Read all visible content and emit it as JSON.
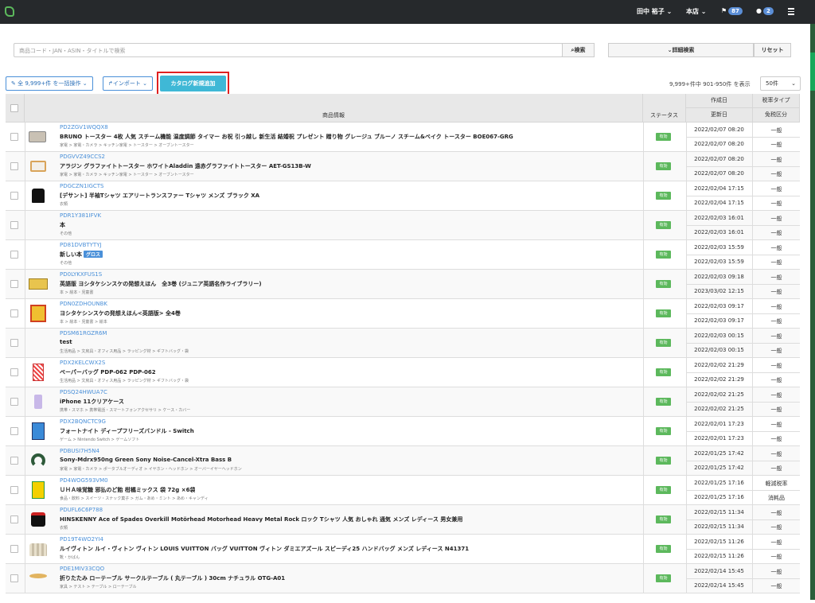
{
  "topbar": {
    "user": "田中 裕子",
    "store": "本店",
    "flag_count": "87",
    "chat_count": "2"
  },
  "search": {
    "placeholder": "商品コード・JAN・ASIN・タイトルで検索",
    "search_label": "検索",
    "advanced_label": "詳細検索",
    "reset_label": "リセット"
  },
  "actions": {
    "bulk_label": "全 9,999+件 を一括操作",
    "import_label": "インポート",
    "add_label": "カタログ新規追加"
  },
  "paging": {
    "info": "9,999+件中 901-950件 を表示",
    "per_page": "50件"
  },
  "table": {
    "headers": {
      "product": "商品情報",
      "status": "ステータス",
      "created": "作成日",
      "updated": "更新日",
      "tax": "税率タイプ",
      "excise": "免税区分"
    },
    "rows": [
      {
        "code": "PD2ZGV1WQQX8",
        "title": "BRUNO トースター 4枚 人気 スチーム機能 温度調節 タイマー お祝 引っ越し 新生活 結婚祝 プレゼント 贈り物 グレージュ ブルーノ スチーム&ベイク トースター BOE067-GRG",
        "category": "家電 > 家電・カメラ > キッチン家電 > トースター > オーブントースター",
        "status": "有効",
        "created": "2022/02/07 08:20",
        "updated": "2022/02/07 08:20",
        "tax": "一般",
        "excise": "一般",
        "thumb": "toaster"
      },
      {
        "code": "PDGVVZ49CCS2",
        "title": "アラジン グラファイトトースター ホワイトAladdin 遠赤グラファイトトースター AET-GS13B-W",
        "category": "家電 > 家電・カメラ > キッチン家電 > トースター > オーブントースター",
        "status": "有効",
        "created": "2022/02/07 08:20",
        "updated": "2022/02/07 08:20",
        "tax": "一般",
        "excise": "一般",
        "thumb": "toaster2"
      },
      {
        "code": "PDGCZN1IGCTS",
        "title": "[デサント] 半袖Tシャツ エアリートランスファー Tシャツ メンズ ブラック XA",
        "category": "衣類",
        "status": "有効",
        "created": "2022/02/04 17:15",
        "updated": "2022/02/04 17:15",
        "tax": "一般",
        "excise": "一般",
        "thumb": "tshirt"
      },
      {
        "code": "PDR1Y381IFVK",
        "title": "本",
        "category": "その他",
        "status": "有効",
        "created": "2022/02/03 16:01",
        "updated": "2022/02/03 16:01",
        "tax": "一般",
        "excise": "一般",
        "thumb": ""
      },
      {
        "code": "PD81DVBTYTYJ",
        "title": "新しい本",
        "tag": "グロス",
        "category": "その他",
        "status": "有効",
        "created": "2022/02/03 15:59",
        "updated": "2022/02/03 15:59",
        "tax": "一般",
        "excise": "一般",
        "thumb": ""
      },
      {
        "code": "PD0LYKXFUS1S",
        "title": "英語版 ヨシタケシンスケの発想えほん　全3巻 (ジュニア英語名作ライブラリー)",
        "category": "本 > 絵本・児童書",
        "status": "有効",
        "created": "2022/02/03 09:18",
        "updated": "2023/03/02 12:15",
        "tax": "一般",
        "excise": "一般",
        "thumb": "books"
      },
      {
        "code": "PDN0ZDHOUNBK",
        "title": "ヨシタケシンスケの発想えほん<英語版> 全4巻",
        "category": "本 > 絵本・児童書 > 絵本",
        "status": "有効",
        "created": "2022/02/03 09:17",
        "updated": "2022/02/03 09:17",
        "tax": "一般",
        "excise": "一般",
        "thumb": "book"
      },
      {
        "code": "PDSM61RGZR6M",
        "title": "test",
        "category": "生活用品 > 文房具・オフィス用品 > ラッピング材 > ギフトバッグ・袋",
        "status": "有効",
        "created": "2022/02/03 00:15",
        "updated": "2022/02/03 00:15",
        "tax": "一般",
        "excise": "一般",
        "thumb": ""
      },
      {
        "code": "PDX2KELCWX2S",
        "title": "ペーパーバッグ PDP-062 PDP-062",
        "category": "生活用品 > 文房具・オフィス用品 > ラッピング材 > ギフトバッグ・袋",
        "status": "有効",
        "created": "2022/02/02 21:29",
        "updated": "2022/02/02 21:29",
        "tax": "一般",
        "excise": "一般",
        "thumb": "bag"
      },
      {
        "code": "PDSQ24HWUA7C",
        "title": "iPhone 11クリアケース",
        "category": "携帯・スマホ > 携帯電話・スマートフォンアクセサリ > ケース・カバー",
        "status": "有効",
        "created": "2022/02/02 21:25",
        "updated": "2022/02/02 21:25",
        "tax": "一般",
        "excise": "一般",
        "thumb": "phone"
      },
      {
        "code": "PDX2BQNCTC9G",
        "title": "フォートナイト ディープフリーズバンドル - Switch",
        "category": "ゲーム > Nintendo Switch > ゲームソフト",
        "status": "有効",
        "created": "2022/02/01 17:23",
        "updated": "2022/02/01 17:23",
        "tax": "一般",
        "excise": "一般",
        "thumb": "game"
      },
      {
        "code": "PDBUSI7H5N4",
        "title": "Sony-Mdrx950ng Green Sony Noise-Cancel-Xtra Bass B",
        "category": "家電 > 家電・カメラ > ポータブルオーディオ > イヤホン・ヘッドホン > オーバーイヤーヘッドホン",
        "status": "有効",
        "created": "2022/01/25 17:42",
        "updated": "2022/01/25 17:42",
        "tax": "一般",
        "excise": "一般",
        "thumb": "headphones"
      },
      {
        "code": "PD4WOG593VM0",
        "title": "ＵＨＡ味覚糖 邪払のど飴 柑橘ミックス 袋 72g ×6袋",
        "category": "食品・飲料 > スイーツ・スナック菓子 > ガム・あめ・ミント > あめ・キャンディ",
        "status": "有効",
        "created": "2022/01/25 17:16",
        "updated": "2022/01/25 17:16",
        "tax": "軽減税率",
        "excise": "消耗品",
        "thumb": "candy"
      },
      {
        "code": "PDUFL6C6P788",
        "title": "HINSKENNY Ace of Spades Overkill Motörhead Motorhead Heavy Metal Rock ロック Tシャツ 人気 おしゃれ 通気 メンズ レディース 男女兼用",
        "category": "衣類",
        "status": "有効",
        "created": "2022/02/15 11:34",
        "updated": "2022/02/15 11:34",
        "tax": "一般",
        "excise": "一般",
        "thumb": "tshirt2"
      },
      {
        "code": "PD19T4WO2YI4",
        "title": "ルイヴィトン ルイ・ヴィトン ヴィトン LOUIS VUITTON バッグ VUITTON ヴィトン ダミエアズール スピーディ25 ハンドバッグ メンズ レディース N41371",
        "category": "靴・かばん",
        "status": "有効",
        "created": "2022/02/15 11:26",
        "updated": "2022/02/15 11:26",
        "tax": "一般",
        "excise": "一般",
        "thumb": "lvbag"
      },
      {
        "code": "PDE1MIV33CQO",
        "title": "折りたたみ ローテーブル サークルテーブル ( 丸テーブル ) 30cm ナチュラル OTG-A01",
        "category": "家具 > テスト > テーブル > ローテーブル",
        "status": "有効",
        "created": "2022/02/14 15:45",
        "updated": "2022/02/14 15:45",
        "tax": "一般",
        "excise": "一般",
        "thumb": "table"
      }
    ]
  }
}
